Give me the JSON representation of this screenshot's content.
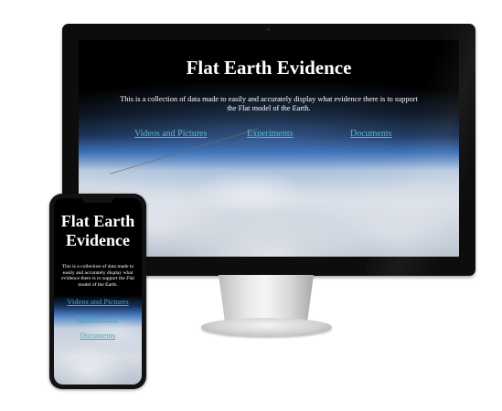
{
  "site": {
    "title": "Flat Earth Evidence",
    "intro": "This is a collection of data made to easily and accurately display what evidence there is to support the Flat model of the Earth.",
    "nav": [
      {
        "label": "Videos and Pictures"
      },
      {
        "label": "Experiments"
      },
      {
        "label": "Documents"
      }
    ]
  },
  "mobile_title_lines": [
    "Flat Earth",
    "Evidence"
  ],
  "colors": {
    "link": "#58b7c4",
    "page_background_top": "#000000",
    "device_frame": "#0d0d0d"
  },
  "icons": {
    "device_camera": "camera-dot-icon"
  }
}
